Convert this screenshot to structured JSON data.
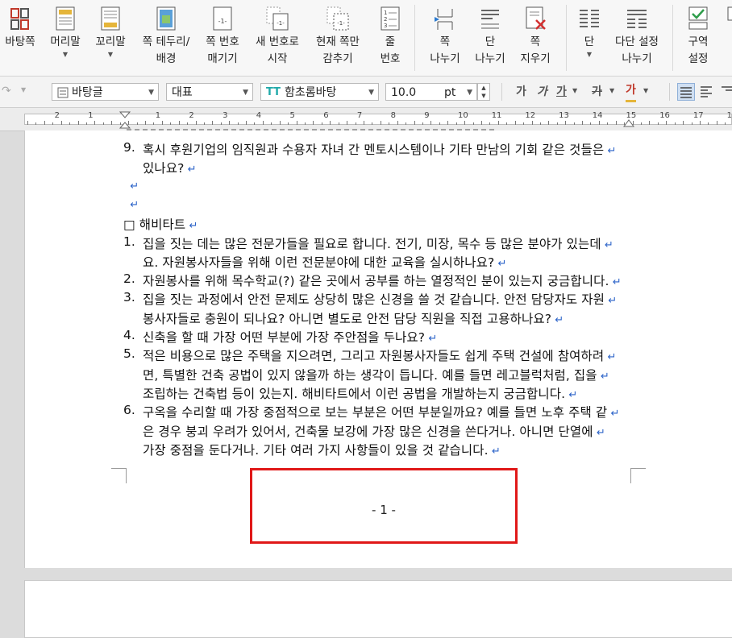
{
  "ribbon": {
    "buttons": [
      {
        "id": "page-background",
        "label": "바탕쪽",
        "icon": "page-background-icon",
        "caret": false
      },
      {
        "id": "header",
        "label": "머리말",
        "icon": "header-icon",
        "caret": true
      },
      {
        "id": "footer",
        "label": "꼬리말",
        "icon": "footer-icon",
        "caret": true
      },
      {
        "id": "page-border",
        "label": "쪽 테두리/\n배경",
        "icon": "page-border-icon",
        "caret": false
      },
      {
        "id": "page-number",
        "label": "쪽 번호\n매기기",
        "icon": "page-number-icon",
        "caret": false
      },
      {
        "id": "new-number",
        "label": "새 번호로\n시작",
        "icon": "new-number-icon",
        "caret": false
      },
      {
        "id": "hide-page",
        "label": "현재 쪽만\n감추기",
        "icon": "hide-page-icon",
        "caret": false
      },
      {
        "id": "line-number",
        "label": "줄\n번호",
        "icon": "line-number-icon",
        "caret": true
      },
      {
        "id": "page-break",
        "label": "쪽\n나누기",
        "icon": "page-break-icon",
        "caret": false
      },
      {
        "id": "column-break",
        "label": "단\n나누기",
        "icon": "column-break-icon",
        "caret": false
      },
      {
        "id": "delete-page",
        "label": "쪽\n지우기",
        "icon": "delete-page-icon",
        "caret": false
      },
      {
        "id": "columns",
        "label": "단",
        "icon": "columns-icon",
        "caret": true
      },
      {
        "id": "multi-column",
        "label": "다단 설정\n나누기",
        "icon": "multi-column-icon",
        "caret": false
      },
      {
        "id": "section",
        "label": "구역\n설정",
        "icon": "section-icon",
        "caret": false
      }
    ]
  },
  "toolbar": {
    "style": "바탕글",
    "language": "대표",
    "font": "함초롬바탕",
    "font_icon": "TT",
    "size": "10.0",
    "unit": "pt",
    "bold": "가",
    "italic": "가",
    "underline": "가",
    "strike": "가",
    "color": "가"
  },
  "ruler": {
    "numbers": [
      "2",
      "1",
      "",
      "1",
      "2",
      "3",
      "4",
      "5",
      "6",
      "7",
      "8",
      "9",
      "10",
      "11",
      "12",
      "13",
      "14",
      "15",
      "16",
      "17",
      "18"
    ]
  },
  "document": {
    "lines": [
      {
        "num": "9.",
        "text": "혹시 후원기업의 임직원과 수용자 자녀 간 멘토시스템이나 기타 만남의 기회 같은 것들은"
      },
      {
        "num": "",
        "text": "있나요?"
      },
      {
        "num": "",
        "text": ""
      },
      {
        "num": "",
        "text": ""
      },
      {
        "num": "",
        "text": "□ 해비타트"
      },
      {
        "num": "1.",
        "text": "집을 짓는 데는 많은 전문가들을 필요로 합니다. 전기, 미장, 목수 등 많은 분야가 있는데"
      },
      {
        "num": "",
        "text": "요. 자원봉사자들을 위해 이런 전문분야에 대한 교육을 실시하나요?"
      },
      {
        "num": "2.",
        "text": "자원봉사를 위해 목수학교(?) 같은 곳에서 공부를 하는 열정적인 분이 있는지 궁금합니다."
      },
      {
        "num": "3.",
        "text": "집을 짓는 과정에서 안전 문제도 상당히 많은 신경을 쓸 것 같습니다. 안전 담당자도 자원"
      },
      {
        "num": "",
        "text": "봉사자들로 충원이 되나요? 아니면 별도로 안전 담당 직원을 직접 고용하나요?"
      },
      {
        "num": "4.",
        "text": "신축을 할 때 가장 어떤 부분에 가장 주안점을 두나요?"
      },
      {
        "num": "5.",
        "text": "적은 비용으로 많은 주택을 지으려면, 그리고 자원봉사자들도 쉽게 주택 건설에 참여하려"
      },
      {
        "num": "",
        "text": "면, 특별한 건축 공법이 있지 않을까 하는 생각이 듭니다. 예를 들면 레고블럭처럼, 집을"
      },
      {
        "num": "",
        "text": "조립하는 건축법 등이 있는지. 해비타트에서 이런 공법을 개발하는지 궁금합니다."
      },
      {
        "num": "6.",
        "text": "구옥을 수리할 때 가장 중점적으로 보는 부분은 어떤 부분일까요? 예를 들면 노후 주택 같"
      },
      {
        "num": "",
        "text": "은 경우 붕괴 우려가 있어서, 건축물 보강에 가장 많은 신경을 쓴다거나. 아니면 단열에"
      },
      {
        "num": "",
        "text": "가장 중점을 둔다거나. 기타 여러 가지 사항들이 있을 것 같습니다."
      }
    ],
    "page_number": "- 1 -"
  },
  "colors": {
    "highlight_box": "#e01818",
    "return_mark": "#2a62c8"
  }
}
